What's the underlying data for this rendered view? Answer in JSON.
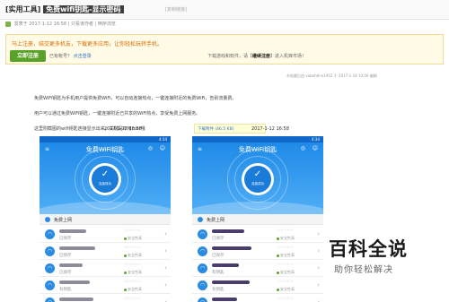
{
  "header": {
    "category": "[实用工具]",
    "title": "免费wifi钥匙-显示密码",
    "tag": "[复制链接]"
  },
  "meta": {
    "author": "发表于 2017-1-12 16:58",
    "separator": "|",
    "only_author": "只看该作者",
    "reverse": "倒序浏览"
  },
  "notice": {
    "line1": "马上注册，结交更多机友，下载更多应用，让你轻松玩转手机。",
    "login_button": "立即注册",
    "line2_prefix": "已有帐号？",
    "line2_link": "点击登录",
    "right_prefix": "下载游戏和软件，请【",
    "right_bold": "继续注册",
    "right_suffix": "】进入机锋市场！"
  },
  "post": {
    "signature": "本帖最后由 vabehtine1952 于 2017-1-18 10:06 编辑",
    "p1": "免费WiFi钥匙为手机用户提供免费WiFi，可以自动连接热点，一键连接附近的免费WiFi，告别流量费。",
    "p2": "用户可以通过免费WiFi钥匙，一键连接附近已共享的WiFi热点，享受免费上网服务。",
    "p3": "这里附截图的wifi钥匙连接显示出来，关键是不用root哦"
  },
  "caption": {
    "link": "下载附件 (46.5 KB)",
    "date_right": "2017-1-12 16:58"
  },
  "shots": [
    {
      "date": "2017-1-12 16:58",
      "title": "免费WiFi钥匙",
      "time": "4:34",
      "badge": "连接成功",
      "section": "免费上网",
      "rows": [
        {
          "sub": "已保存",
          "stars": "☆☆☆☆☆",
          "safe": "安全性高"
        },
        {
          "sub": "已保存",
          "stars": "☆☆☆☆☆",
          "safe": "安全性高"
        },
        {
          "sub": "已保存",
          "stars": "☆☆☆☆☆",
          "safe": "安全性高"
        },
        {
          "sub": "有钥匙",
          "stars": "☆☆☆☆☆",
          "safe": "安全性高"
        },
        {
          "sub": "有钥匙",
          "stars": "☆☆☆☆☆",
          "safe": "安全性高"
        }
      ]
    },
    {
      "date": "2017-1-12 16:58",
      "title": "免费WiFi钥匙",
      "time": "4:34",
      "badge": "连接成功",
      "section": "免费上网",
      "rows": [
        {
          "sub": "已保存",
          "stars": "☆☆☆☆☆",
          "safe": "安全性高"
        },
        {
          "sub": "已保存",
          "stars": "☆☆☆☆☆",
          "safe": "安全性高"
        },
        {
          "sub": "有钥匙",
          "stars": "☆☆☆☆☆",
          "safe": "安全性高"
        },
        {
          "sub": "有钥匙",
          "stars": "☆☆☆☆☆",
          "safe": "安全性高"
        },
        {
          "sub": "有钥匙",
          "stars": "☆☆☆☆☆",
          "safe": "安全性高"
        }
      ]
    }
  ],
  "watermark": {
    "main": "百科全说",
    "sub": "助你轻松解决"
  },
  "colors": {
    "accent": "#1f8ae8",
    "login": "#5aa12a",
    "notice": "#d96b00",
    "link": "#3374c4"
  }
}
